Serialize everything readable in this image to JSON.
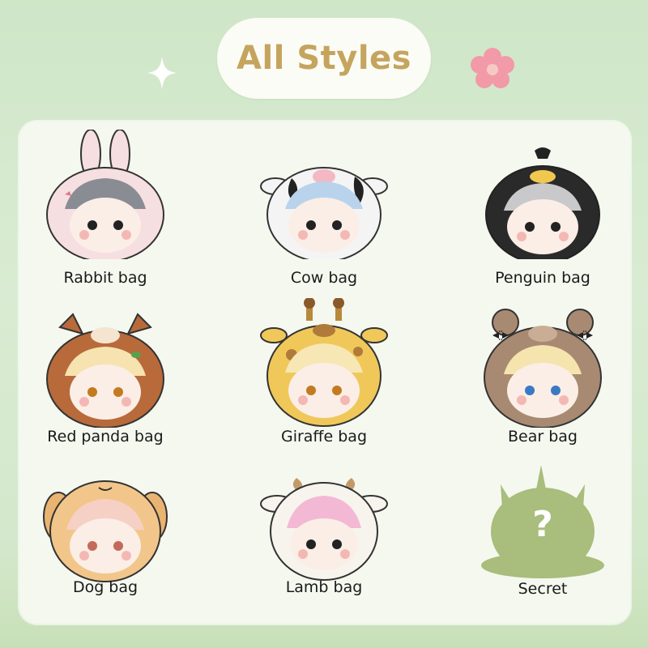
{
  "header": {
    "title": "All Styles"
  },
  "items": [
    {
      "label": "Rabbit bag",
      "hood_color": "#f6dfe1",
      "hair_color": "#8a8c94",
      "icon": "rabbit-hood"
    },
    {
      "label": "Cow bag",
      "hood_color": "#f4f4f4",
      "hair_color": "#b9d3ec",
      "icon": "cow-hood"
    },
    {
      "label": "Penguin bag",
      "hood_color": "#2a2a2a",
      "hair_color": "#c9c9cc",
      "icon": "penguin-hood"
    },
    {
      "label": "Red panda bag",
      "hood_color": "#b86a3a",
      "hair_color": "#f6e3b0",
      "icon": "red-panda-hood"
    },
    {
      "label": "Giraffe bag",
      "hood_color": "#f0c85a",
      "hair_color": "#f7e7b5",
      "icon": "giraffe-hood"
    },
    {
      "label": "Bear bag",
      "hood_color": "#a88a72",
      "hair_color": "#f6e4ae",
      "icon": "bear-hood"
    },
    {
      "label": "Dog bag",
      "hood_color": "#f2c68a",
      "hair_color": "#f6d0c4",
      "icon": "dog-hood"
    },
    {
      "label": "Lamb bag",
      "hood_color": "#f7f4ee",
      "hair_color": "#f3b8d4",
      "icon": "lamb-hood"
    },
    {
      "label": "Secret",
      "hood_color": "#a9bd7c",
      "hair_color": "",
      "icon": "secret-silhouette"
    }
  ],
  "secret_mark": "?"
}
